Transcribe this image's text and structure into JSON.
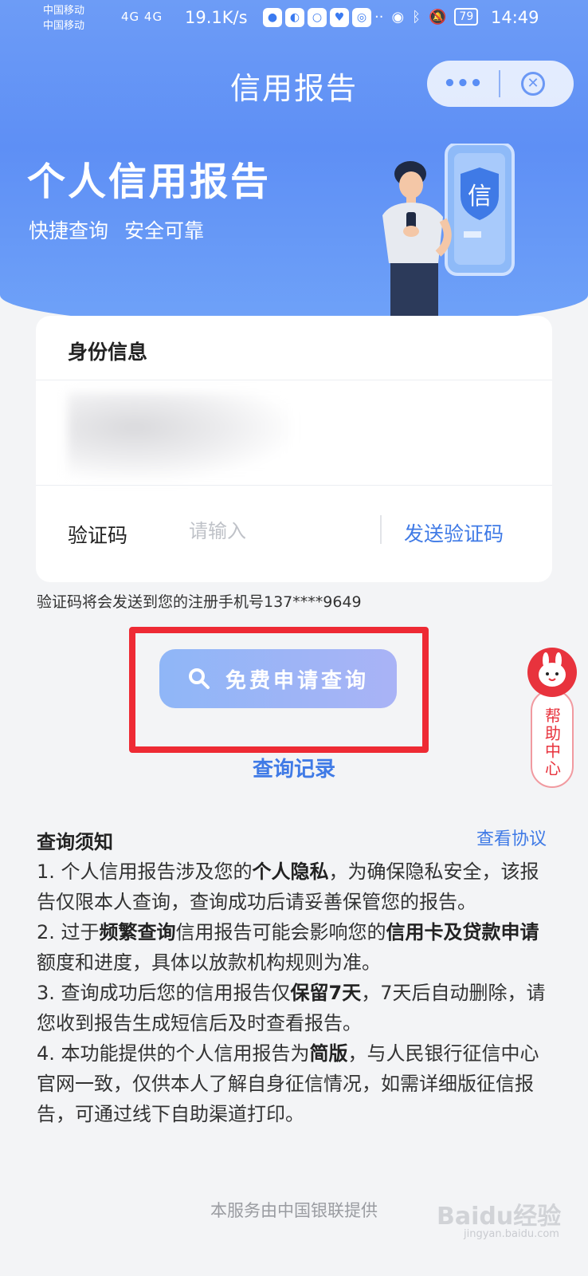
{
  "status_bar": {
    "carrier_1": "中国移动",
    "carrier_2": "中国移动",
    "signal": "4G 4G",
    "net_speed": "19.1K/s",
    "battery": "79",
    "time": "14:49"
  },
  "nav": {
    "title": "信用报告",
    "more": "•••",
    "close": "✕"
  },
  "hero": {
    "title": "个人信用报告",
    "subtitle": "快捷查询  安全可靠",
    "badge_char": "信"
  },
  "identity_card": {
    "title": "身份信息",
    "code_label": "验证码",
    "code_placeholder": "请输入",
    "send_code": "发送验证码"
  },
  "hint": "验证码将会发送到您的注册手机号137****9649",
  "apply_button": "免费申请查询",
  "records_link": "查询记录",
  "help_center": "帮助中心",
  "notice": {
    "title": "查询须知",
    "agreement_link": "查看协议",
    "items": [
      {
        "a": "1. 个人信用报告涉及您的",
        "b": "个人隐私",
        "c": "，为确保隐私安全，该报告仅限本人查询，查询成功后请妥善保管您的报告。"
      },
      {
        "a": "2. 过于",
        "b": "频繁查询",
        "c": "信用报告可能会影响您的",
        "d": "信用卡及贷款申请",
        "e": "额度和进度，具体以放款机构规则为准。"
      },
      {
        "a": "3. 查询成功后您的信用报告仅",
        "b": "保留7天",
        "c": "，7天后自动删除，请您收到报告生成短信后及时查看报告。"
      },
      {
        "a": "4. 本功能提供的个人信用报告为",
        "b": "简版",
        "c": "，与人民银行征信中心官网一致，仅供本人了解自身征信情况，如需详细版征信报告，可通过线下自助渠道打印。"
      }
    ]
  },
  "footer": "本服务由中国银联提供",
  "watermark": "Baidu经验",
  "watermark_sub": "jingyan.baidu.com"
}
